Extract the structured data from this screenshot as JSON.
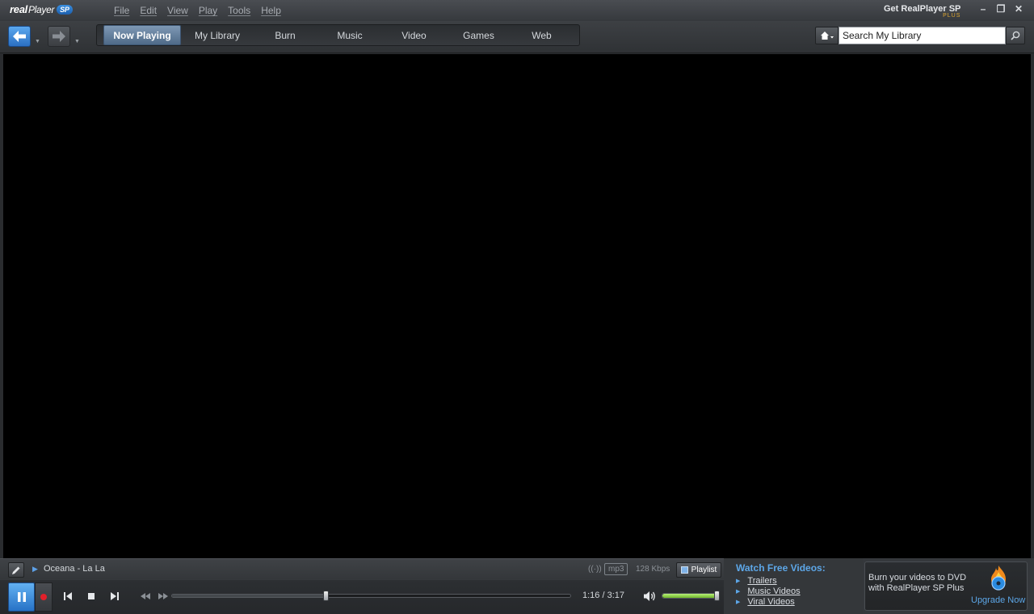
{
  "app": {
    "logo_brand": "real",
    "logo_player": "Player",
    "logo_badge": "SP",
    "upsell_title": "Get RealPlayer SP",
    "upsell_sub": "PLUS"
  },
  "menu": [
    "File",
    "Edit",
    "View",
    "Play",
    "Tools",
    "Help"
  ],
  "window_controls": {
    "minimize": "–",
    "restore": "❐",
    "close": "✕"
  },
  "tabs": [
    {
      "label": "Now Playing",
      "active": true
    },
    {
      "label": "My Library",
      "active": false
    },
    {
      "label": "Burn",
      "active": false
    },
    {
      "label": "Music",
      "active": false
    },
    {
      "label": "Video",
      "active": false
    },
    {
      "label": "Games",
      "active": false
    },
    {
      "label": "Web",
      "active": false
    }
  ],
  "search": {
    "value": "Search My Library",
    "placeholder": "Search My Library"
  },
  "now_playing": {
    "track": "Oceana - La La",
    "format": "mp3",
    "bitrate": "128 Kbps",
    "stream_icon": "((·))",
    "playlist_label": "Playlist",
    "time": "1:16 / 3:17",
    "progress": 0.386,
    "volume": 0.98
  },
  "promo": {
    "heading": "Watch Free Videos:",
    "links": [
      "Trailers",
      "Music Videos",
      "Viral Videos"
    ]
  },
  "ad": {
    "line1": "Burn your videos to DVD",
    "line2": "with RealPlayer SP Plus",
    "cta": "Upgrade Now"
  },
  "colors": {
    "accent": "#2b6fc2",
    "link": "#5da7e8",
    "record": "#e2202a",
    "volume": "#8ed24a",
    "upsell": "#e0a830"
  }
}
